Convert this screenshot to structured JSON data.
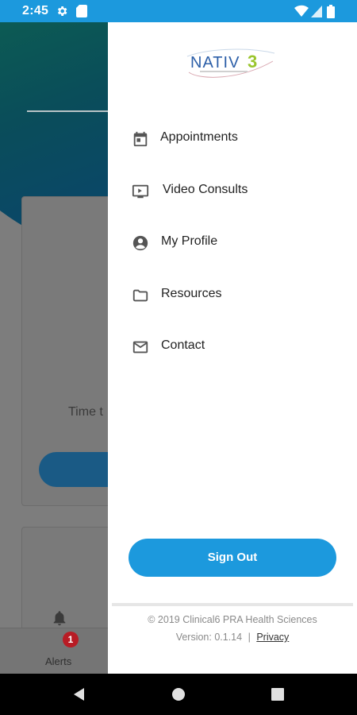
{
  "status_bar": {
    "time": "2:45",
    "icons": [
      "settings-icon",
      "sd-card-icon",
      "wifi-icon",
      "signal-icon",
      "battery-icon"
    ],
    "color": "#1c99dd"
  },
  "background_app": {
    "card_text": "Time t",
    "tab_alerts_label": "Alerts",
    "alerts_badge": "1"
  },
  "drawer": {
    "logo_text": "NATIV3",
    "menu": [
      {
        "label": "Appointments",
        "icon": "calendar-icon"
      },
      {
        "label": "Video Consults",
        "icon": "video-icon"
      },
      {
        "label": "My Profile",
        "icon": "account-icon"
      },
      {
        "label": "Resources",
        "icon": "folder-icon"
      },
      {
        "label": "Contact",
        "icon": "mail-icon"
      }
    ],
    "sign_out_label": "Sign Out",
    "copyright": "© 2019 Clinical6 PRA Health Sciences",
    "version": "Version: 0.1.14",
    "separator": "|",
    "privacy_label": "Privacy",
    "accent_color": "#1c99dd"
  }
}
